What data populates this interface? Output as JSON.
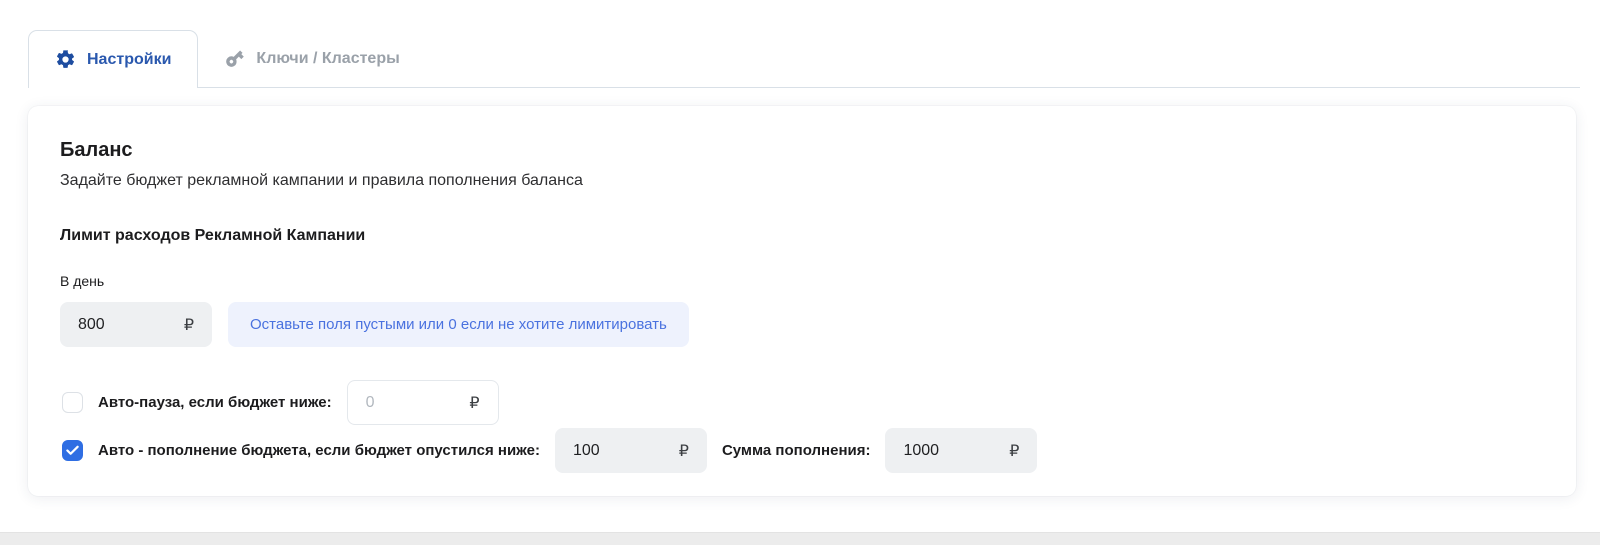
{
  "tabs": [
    {
      "label": "Настройки",
      "icon": "gear-icon",
      "active": true
    },
    {
      "label": "Ключи / Кластеры",
      "icon": "key-icon",
      "active": false
    }
  ],
  "balance": {
    "title": "Баланс",
    "subtitle": "Задайте бюджет рекламной кампании и правила пополнения баланса",
    "currency": "₽",
    "limit_section": {
      "title": "Лимит расходов Рекламной Кампании",
      "per_day_label": "В день",
      "per_day_value": "800",
      "hint": "Оставьте поля пустыми или 0 если не хотите лимитировать"
    },
    "auto_pause": {
      "checked": false,
      "label": "Авто-пауза, если бюджет ниже:",
      "placeholder": "0"
    },
    "auto_topup": {
      "checked": true,
      "label": "Авто - пополнение бюджета, если бюджет опустился ниже:",
      "threshold_value": "100",
      "topup_label": "Сумма пополнения:",
      "topup_value": "1000"
    }
  },
  "colors": {
    "active_tab_text": "#2a58ae",
    "inactive_tab_text": "#9aa1a9",
    "checkbox_blue": "#2f6ee3",
    "hint_text": "#4a72df",
    "hint_bg": "#eef2fd",
    "input_bg": "#eef0f2",
    "tab_border": "#d9e0e7"
  }
}
